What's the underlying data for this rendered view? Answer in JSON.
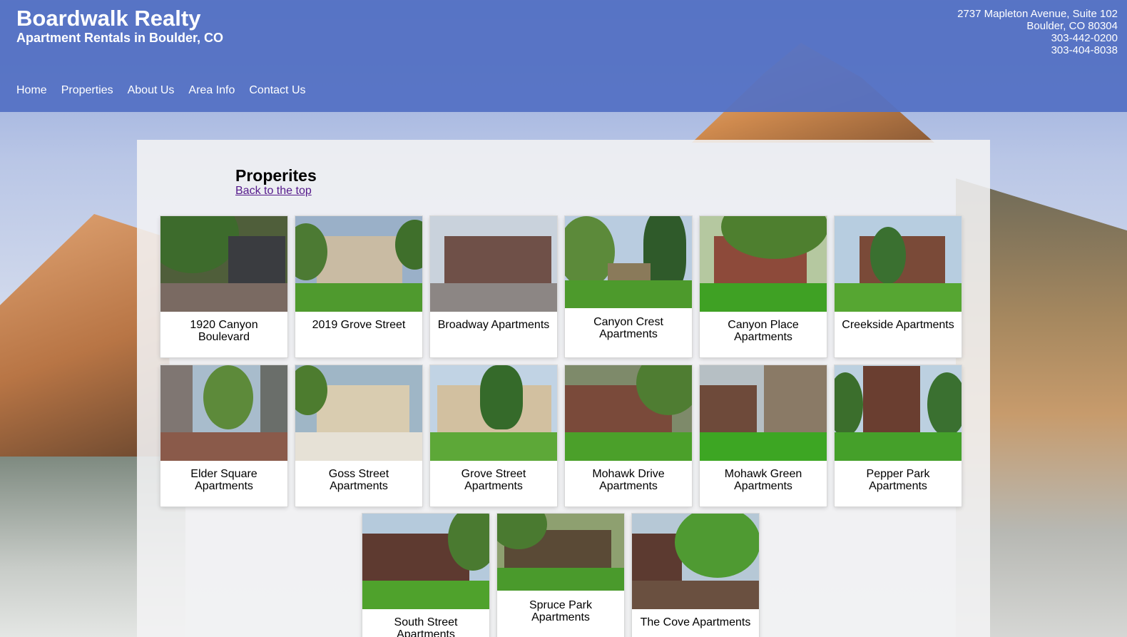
{
  "header": {
    "title": "Boardwalk Realty",
    "subtitle": "Apartment Rentals in Boulder, CO",
    "contact": {
      "address_line1": "2737 Mapleton Avenue, Suite 102",
      "address_line2": "Boulder, CO 80304",
      "phone1": "303-442-0200",
      "phone2": "303-404-8038"
    }
  },
  "nav": {
    "items": [
      "Home",
      "Properties",
      "About Us",
      "Area Info",
      "Contact Us"
    ]
  },
  "main": {
    "heading": "Properites",
    "back_link": "Back to the top",
    "properties": [
      {
        "label": "1920 Canyon Boulevard"
      },
      {
        "label": "2019 Grove Street"
      },
      {
        "label": "Broadway Apartments"
      },
      {
        "label": "Canyon Crest Apartments"
      },
      {
        "label": "Canyon Place Apartments"
      },
      {
        "label": "Creekside Apartments"
      },
      {
        "label": "Elder Square Apartments"
      },
      {
        "label": "Goss Street Apartments"
      },
      {
        "label": "Grove Street Apartments"
      },
      {
        "label": "Mohawk Drive Apartments"
      },
      {
        "label": "Mohawk Green Apartments"
      },
      {
        "label": "Pepper Park Apartments"
      },
      {
        "label": "South Street Apartments"
      },
      {
        "label": "Spruce Park Apartments"
      },
      {
        "label": "The Cove Apartments"
      }
    ]
  },
  "colors": {
    "header_bg": "#5471c4",
    "link_visited": "#551a8b"
  }
}
